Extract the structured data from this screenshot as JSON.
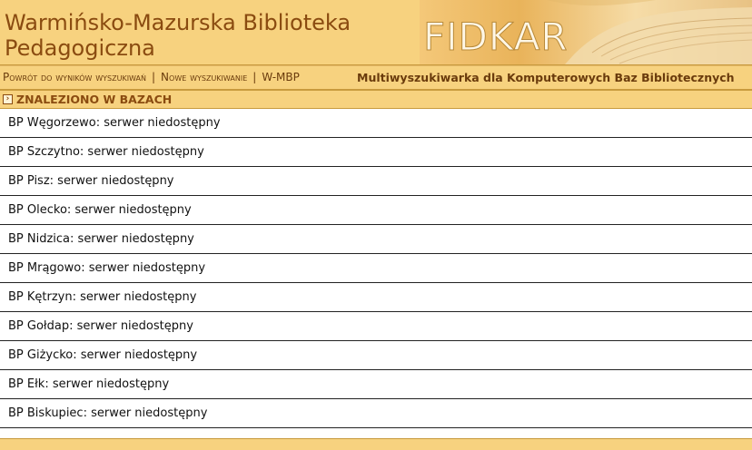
{
  "header": {
    "title_line1": "Warmińsko-Mazurska Biblioteka",
    "title_line2": "Pedagogiczna",
    "banner_text": "FIDKAR"
  },
  "nav": {
    "back_link": "Powrót do wyników wyszukiwań",
    "new_search_link": "Nowe wyszukiwanie",
    "home_link": "W-MBP",
    "tagline": "Multiwyszukiwarka dla Komputerowych Baz Bibliotecznych"
  },
  "section": {
    "title": "ZNALEZIONO W BAZACH"
  },
  "results": [
    "BP Węgorzewo: serwer niedostępny",
    "BP Szczytno: serwer niedostępny",
    "BP Pisz: serwer niedostępny",
    "BP Olecko: serwer niedostępny",
    "BP Nidzica: serwer niedostępny",
    "BP Mrągowo: serwer niedostępny",
    "BP Kętrzyn: serwer niedostępny",
    "BP Gołdap: serwer niedostępny",
    "BP Giżycko: serwer niedostępny",
    "BP Ełk: serwer niedostępny",
    "BP Biskupiec: serwer niedostępny"
  ],
  "colors": {
    "header_bg": "#f7d27f",
    "title_text": "#8a4b10",
    "nav_text": "#6a3b0c",
    "row_border": "#222222"
  },
  "icons": {
    "section_toggle": "expand-arrow-icon"
  }
}
